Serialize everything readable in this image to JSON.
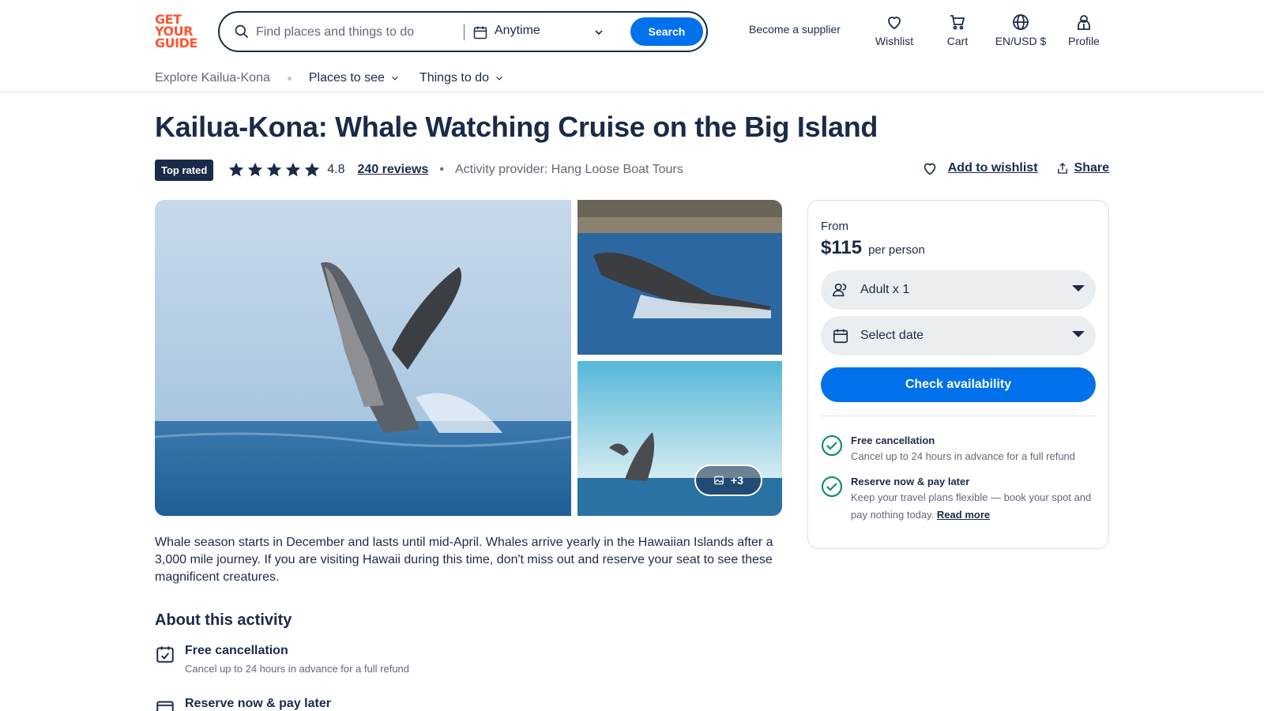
{
  "header": {
    "logo": [
      "GET",
      "YOUR",
      "GUIDE"
    ],
    "search_placeholder": "Find places and things to do",
    "date_value": "Anytime",
    "search_button": "Search",
    "supplier_link": "Become a supplier",
    "nav": [
      {
        "label": "Wishlist",
        "icon": "heart-icon"
      },
      {
        "label": "Cart",
        "icon": "cart-icon"
      },
      {
        "label": "EN/USD $",
        "icon": "globe-icon"
      },
      {
        "label": "Profile",
        "icon": "profile-icon"
      }
    ]
  },
  "subnav": {
    "explore": "Explore Kailua-Kona",
    "links": [
      "Places to see",
      "Things to do"
    ]
  },
  "activity": {
    "title": "Kailua-Kona: Whale Watching Cruise on the Big Island",
    "badge": "Top rated",
    "rating": "4.8",
    "stars": 5,
    "reviews": "240 reviews",
    "provider": "Activity provider: Hang Loose Boat Tours",
    "wishlist_action": "Add to wishlist",
    "share_action": "Share",
    "more_photos": "+3",
    "description": "Whale season starts in December and lasts until mid-April. Whales arrive yearly in the Hawaiian Islands after a 3,000 mile journey. If you are visiting Hawaii during this time, don't miss out and reserve your seat to see these magnificent creatures."
  },
  "about": {
    "heading": "About this activity",
    "items": [
      {
        "title": "Free cancellation",
        "subtitle": "Cancel up to 24 hours in advance for a full refund"
      },
      {
        "title": "Reserve now & pay later",
        "subtitle": ""
      }
    ]
  },
  "booking": {
    "from": "From",
    "price": "$115",
    "per": "per person",
    "participants": "Adult x 1",
    "date_placeholder": "Select date",
    "check_button": "Check availability",
    "perks": [
      {
        "title": "Free cancellation",
        "text": "Cancel up to 24 hours in advance for a full refund"
      },
      {
        "title": "Reserve now & pay later",
        "text": "Keep your travel plans flexible — book your spot and pay nothing today.",
        "link": "Read more"
      }
    ]
  },
  "colors": {
    "brand": "#ff5533",
    "primary": "#0071eb",
    "text": "#1a2b49",
    "check_green": "#008768"
  }
}
